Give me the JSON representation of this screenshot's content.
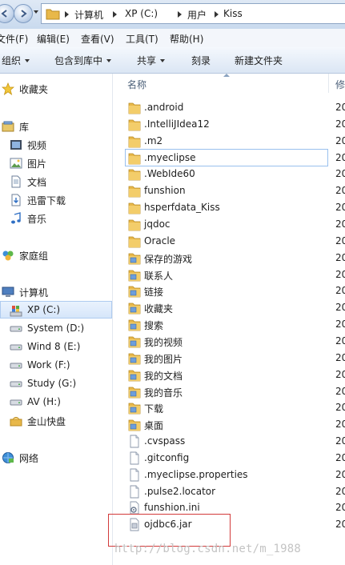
{
  "address": {
    "crumbs": [
      "计算机",
      "XP (C:)",
      "用户",
      "Kiss"
    ]
  },
  "menu": [
    "文件(F)",
    "编辑(E)",
    "查看(V)",
    "工具(T)",
    "帮助(H)"
  ],
  "commands": {
    "organize": "组织",
    "include": "包含到库中",
    "share": "共享",
    "burn": "刻录",
    "new_folder": "新建文件夹"
  },
  "nav": {
    "favorites": "收藏夹",
    "library": "库",
    "video": "视频",
    "pictures": "图片",
    "documents": "文档",
    "thunder": "迅雷下载",
    "music": "音乐",
    "homegroup": "家庭组",
    "computer": "计算机",
    "drives": [
      {
        "label": "XP (C:)"
      },
      {
        "label": "System (D:)"
      },
      {
        "label": "Wind 8 (E:)"
      },
      {
        "label": "Work (F:)"
      },
      {
        "label": "Study (G:)"
      },
      {
        "label": "AV (H:)"
      },
      {
        "label": "金山快盘"
      }
    ],
    "network": "网络"
  },
  "list": {
    "col_name": "名称",
    "col_next": "修",
    "date_prefix": "20",
    "files": [
      {
        "name": ".android",
        "kind": "folder"
      },
      {
        "name": ".IntelliJIdea12",
        "kind": "folder"
      },
      {
        "name": ".m2",
        "kind": "folder"
      },
      {
        "name": ".myeclipse",
        "kind": "folder"
      },
      {
        "name": ".WebIde60",
        "kind": "folder"
      },
      {
        "name": "funshion",
        "kind": "folder"
      },
      {
        "name": "hsperfdata_Kiss",
        "kind": "folder"
      },
      {
        "name": "jqdoc",
        "kind": "folder"
      },
      {
        "name": "Oracle",
        "kind": "folder"
      },
      {
        "name": "保存的游戏",
        "kind": "special"
      },
      {
        "name": "联系人",
        "kind": "special"
      },
      {
        "name": "链接",
        "kind": "special"
      },
      {
        "name": "收藏夹",
        "kind": "special"
      },
      {
        "name": "搜索",
        "kind": "special"
      },
      {
        "name": "我的视频",
        "kind": "special"
      },
      {
        "name": "我的图片",
        "kind": "special"
      },
      {
        "name": "我的文档",
        "kind": "special"
      },
      {
        "name": "我的音乐",
        "kind": "special"
      },
      {
        "name": "下载",
        "kind": "special"
      },
      {
        "name": "桌面",
        "kind": "special"
      },
      {
        "name": ".cvspass",
        "kind": "file"
      },
      {
        "name": ".gitconfig",
        "kind": "file"
      },
      {
        "name": ".myeclipse.properties",
        "kind": "file"
      },
      {
        "name": ".pulse2.locator",
        "kind": "file"
      },
      {
        "name": "funshion.ini",
        "kind": "ini"
      },
      {
        "name": "ojdbc6.jar",
        "kind": "jar"
      }
    ]
  },
  "watermark": "http://blog.csdn.net/m_1988",
  "colors": {
    "folder": "#e8b84a",
    "selection_border": "#99c0ee",
    "annotation_box": "#d23a3a"
  }
}
